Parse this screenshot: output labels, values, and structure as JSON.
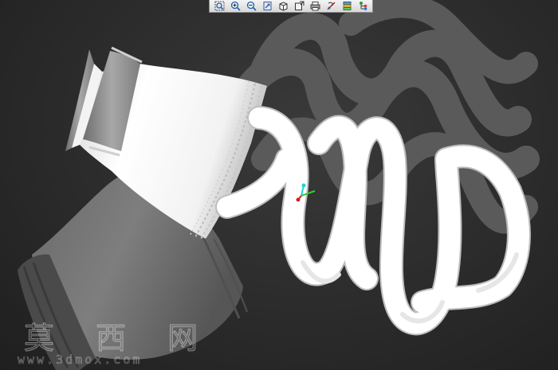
{
  "toolbar": {
    "buttons": [
      {
        "name": "zoom-region-icon"
      },
      {
        "name": "zoom-in-icon"
      },
      {
        "name": "zoom-out-icon"
      },
      {
        "name": "fit-view-icon"
      },
      {
        "name": "view-cube-icon"
      },
      {
        "name": "view-orientation-icon"
      },
      {
        "name": "print-icon"
      },
      {
        "name": "rotate-axis-icon"
      },
      {
        "name": "layers-icon"
      },
      {
        "name": "node-tree-icon"
      }
    ]
  },
  "viewport": {
    "background_color": "#2e2e2e",
    "model_color": "#ffffff",
    "shadow_color": "#5a5a5a"
  },
  "axis_gizmo": {
    "x_color": "#33cc33",
    "y_color": "#22d3d3",
    "z_color": "#d22020"
  },
  "watermark": {
    "text": "莫 西 网",
    "url": "www.3dmox.com"
  }
}
